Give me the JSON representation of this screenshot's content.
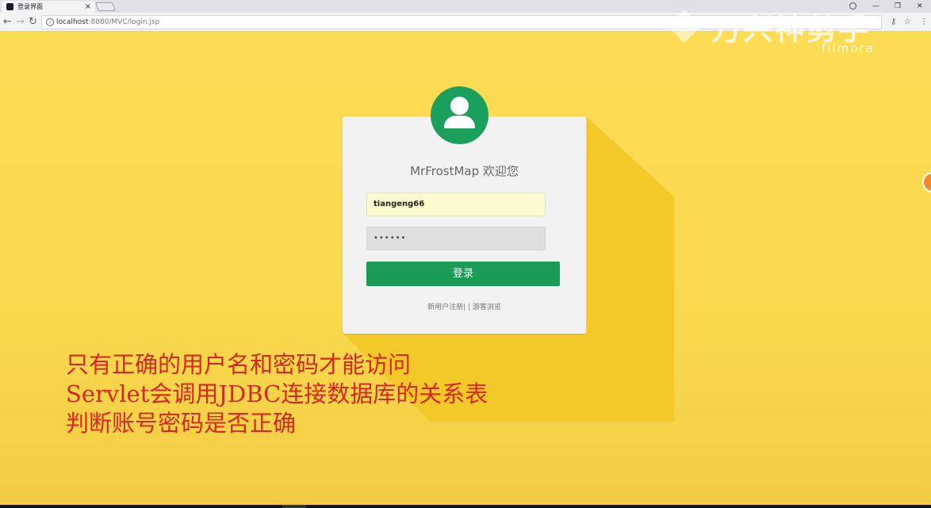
{
  "browser": {
    "tab_title": "登录界面",
    "tab_close": "×",
    "url_host": "localhost",
    "url_path": ":8080/MVC/login.jsp"
  },
  "watermark": {
    "brand_cn": "万兴神剪手",
    "brand_en": "filmora"
  },
  "login": {
    "welcome": "MrFrostMap 欢迎您",
    "username_value": "tiangeng66",
    "password_mask": "••••••",
    "submit_label": "登录",
    "register_link": "新用户注册|",
    "separator": "|",
    "guest_link": "游客浏览"
  },
  "caption": {
    "line1": "只有正确的用户名和密码才能访问",
    "line2": "Servlet会调用JDBC连接数据库的关系表",
    "line3": "判断账号密码是否正确"
  },
  "colors": {
    "background": "#fad94d",
    "accent_green": "#1a9c58",
    "caption_red": "#d42820"
  }
}
